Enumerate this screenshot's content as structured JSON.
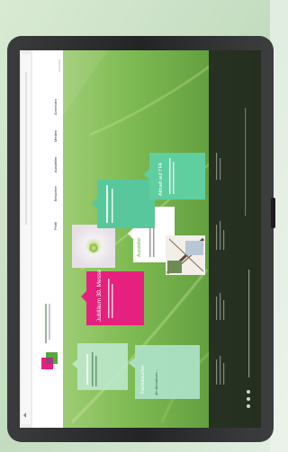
{
  "screen": {
    "nav": [
      "Profil",
      "Besucher",
      "Aussteller",
      "Medien",
      "Anmelden"
    ],
    "cards": {
      "visitor": {
        "title": "Fachbesucher",
        "link": "alle Informationen →"
      },
      "anniversary": {
        "title": "Jubiläum 30. Messe"
      },
      "exhibitor": {
        "title": "Aussteller"
      },
      "news": {
        "title": "Aktuell auf TFA"
      }
    }
  },
  "colors": {
    "accent": "#e6207f",
    "card_green": "#8ed7b9",
    "device": "#2b2c2e",
    "footer": "#22291f"
  },
  "icons": [
    "browser-back-icon",
    "social-icons"
  ]
}
